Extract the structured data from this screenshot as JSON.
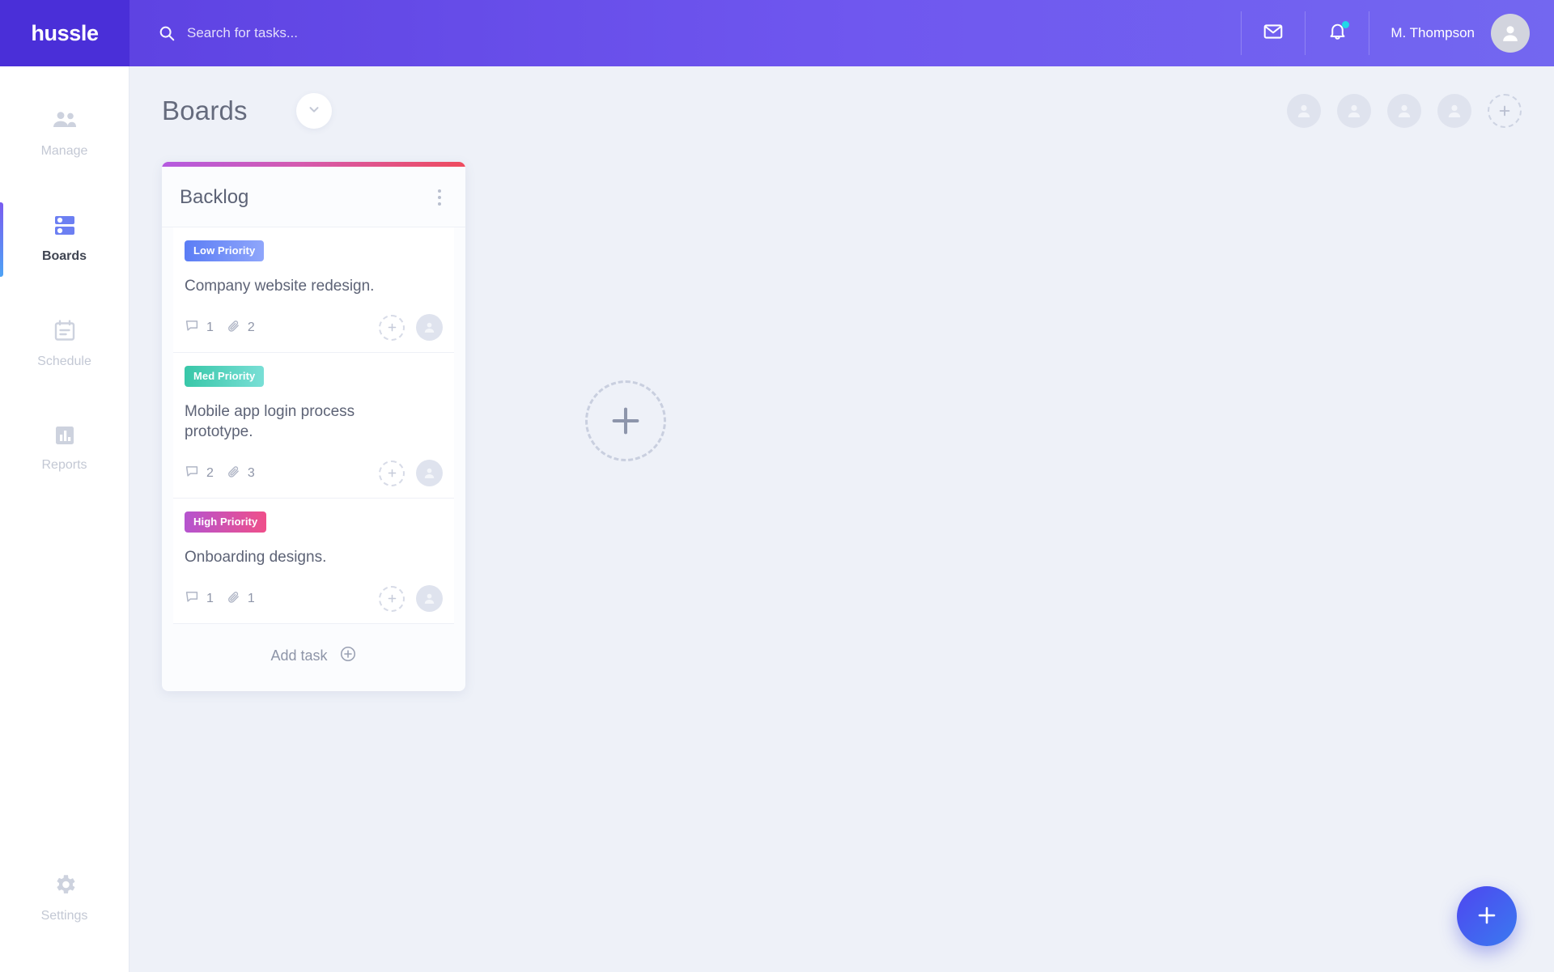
{
  "topbar": {
    "brand": "hussle",
    "search": {
      "placeholder": "Search for tasks...",
      "value": "",
      "icon": "search-icon"
    },
    "mail_icon": "mail-icon",
    "bell_icon": "bell-icon",
    "has_notification": true,
    "user_name": "M. Thompson",
    "avatar_icon": "user-avatar-icon"
  },
  "sidebar": {
    "items": [
      {
        "label": "Manage",
        "icon": "people-icon",
        "active": false
      },
      {
        "label": "Boards",
        "icon": "boards-icon",
        "active": true
      },
      {
        "label": "Schedule",
        "icon": "calendar-icon",
        "active": false
      },
      {
        "label": "Reports",
        "icon": "bar-chart-icon",
        "active": false
      }
    ],
    "bottom": {
      "label": "Settings",
      "icon": "gear-icon",
      "active": false
    }
  },
  "main": {
    "page_title": "Boards",
    "dropdown_icon": "chevron-down-icon",
    "members_count": 4,
    "add_member_label": "+",
    "add_column_label": "+"
  },
  "columns": [
    {
      "title": "Backlog",
      "menu_icon": "more-vertical-icon",
      "accent_from": "#b45ae0",
      "accent_to": "#ef4b5e",
      "add_task_label": "Add task",
      "add_task_icon": "plus-circle-icon",
      "cards": [
        {
          "priority": "Low Priority",
          "priority_class": "low",
          "title": "Company website redesign.",
          "comments": "1",
          "attachments": "2",
          "comment_icon": "comment-icon",
          "attachment_icon": "paperclip-icon"
        },
        {
          "priority": "Med Priority",
          "priority_class": "med",
          "title": "Mobile app login process prototype.",
          "comments": "2",
          "attachments": "3",
          "comment_icon": "comment-icon",
          "attachment_icon": "paperclip-icon"
        },
        {
          "priority": "High Priority",
          "priority_class": "high",
          "title": "Onboarding designs.",
          "comments": "1",
          "attachments": "1",
          "comment_icon": "comment-icon",
          "attachment_icon": "paperclip-icon"
        }
      ]
    }
  ],
  "fab": {
    "icon": "plus-icon",
    "color": "#4e46f0"
  },
  "colors": {
    "topbar": "#6c5ce7",
    "brand_bg": "#4a2fd8",
    "canvas": "#eef1f8",
    "notification_dot": "#1fd8e8",
    "text_muted": "#9aa1b3",
    "text_primary": "#5d6376"
  }
}
